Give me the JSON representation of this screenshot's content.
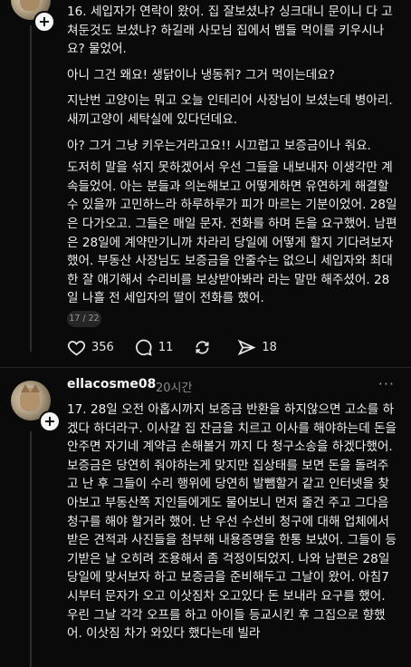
{
  "post1": {
    "paragraphs": [
      "16. 세입자가 연락이 왔어. 집 잘보셨냐? 싱크대니 문이니 다 고쳐둔것도 보셨냐? 하길래 사모님 집에서 뱀들 먹이를 키우시나요? 물었어.",
      "아니 그건 왜요! 생닭이나 냉동쥐? 그거 먹이는데요?",
      "지난번 고양이는 뭐고 오늘 인테리어 사장님이 보셨는데 병아리. 새끼고양이 세탁실에 있다던데요.",
      "아? 그거 그냥 키우는거라고요!! 시끄럽고 보증금이나 줘요.",
      "도저히 말을 섞지 못하겠어서 우선 그들을 내보내자 이생각만 계속들었어. 아는 분들과 의논해보고 어떻게하면 유연하게 해결할 수 있을까 고민하느라 하루하루가 피가 마르는 기분이었어. 28일은 다가오고. 그들은 매일 문자. 전화를 하며 돈을 요구했어. 남편은 28일에 계약만기니까 차라리 당일에 어떻게 할지 기다려보자 했어. 부동산 사장님도 보증금을 안줄수는 없으니 세입자와 최대한 잘 얘기해서 수리비를 보상받아봐라 라는 말만 해주셨어. 28일 나흘 전 세입자의 딸이 전화를 했어."
    ],
    "pager": "17 / 22",
    "likes": "356",
    "comments": "11",
    "shares": "18"
  },
  "post2": {
    "username": "ellacosme08",
    "time": "20시간",
    "more": "···",
    "paragraphs": [
      "17. 28일 오전 아홉시까지 보증금 반환을 하지않으면 고소를 하겠다 하더라구. 이사갈 집 잔금을 치르고 이사를 해야하는데 돈을 안주면 자기네 계약금 손해볼거 까지 다 청구소송을 하겠다했어. 보증금은 당연히 줘야하는게 맞지만 집상태를 보면 돈을 돌려주고 난 후 그들이 수리 행위에 당연히 발뺌할거 같고 인터넷을 찾아보고 부동산쪽 지인들에게도 물어보니 먼저 줄건 주고 그다음 청구를 해야 할거라 했어. 난 우선 수선비 청구에 대해 업체에서 받은 견적과 사진들을 첨부해 내용증명을 한통 보냈어. 그들이 등기받은 날 오히려 조용해서 좀 걱정이되었지. 나와 남편은 28일 당일에 맞서보자 하고 보증금을 준비해두고 그날이 왔어. 아침7시부터 문자가 오고 이삿짐차 오고있다 돈 보내라 요구를 했어. 우린 그날 각각 오프를 하고 아이들 등교시킨 후 그집으로 향했어. 이삿짐 차가 와있다 했다는데 빌라"
    ]
  }
}
